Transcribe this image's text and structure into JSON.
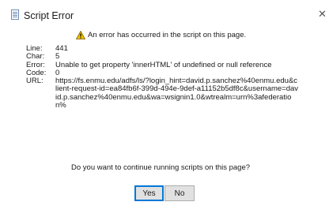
{
  "dialog": {
    "title": "Script Error",
    "close_label": "✕",
    "alert": "An error has occurred in the script on this page.",
    "details": [
      {
        "label": "Line:",
        "value": "441"
      },
      {
        "label": "Char:",
        "value": "5"
      },
      {
        "label": "Error:",
        "value": "Unable to get property 'innerHTML' of undefined or null reference"
      },
      {
        "label": "Code:",
        "value": "0"
      },
      {
        "label": "URL:",
        "value": "https://fs.enmu.edu/adfs/ls/?login_hint=david.p.sanchez%40enmu.edu&client-request-id=ea84fb6f-399d-494e-9def-a11152b5df8c&username=david.p.sanchez%40enmu.edu&wa=wsignin1.0&wtrealm=urn%3afederation%"
      }
    ],
    "question": "Do you want to continue running scripts on this page?",
    "buttons": {
      "yes": "Yes",
      "no": "No"
    }
  },
  "icons": {
    "title": "document-icon",
    "alert": "warning-icon"
  },
  "colors": {
    "warning": "#f2c200",
    "focus_border": "#0078d7",
    "button_face": "#e1e1e1"
  }
}
